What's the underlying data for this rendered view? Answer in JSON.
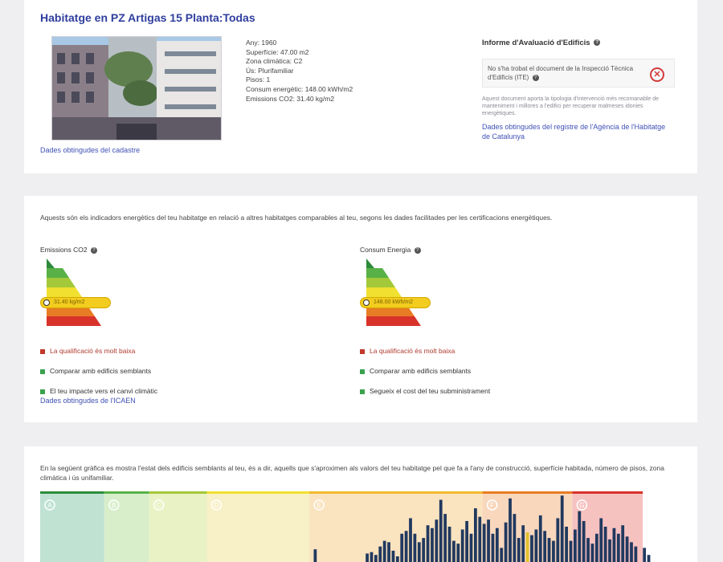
{
  "property": {
    "title": "Habitatge en PZ Artigas 15 Planta:Todas",
    "cadastre_link": "Dades obtingudes del cadastre",
    "facts": [
      "Any: 1960",
      "Superfície: 47.00 m2",
      "Zona climàtica: C2",
      "Ús: Plurifamiliar",
      "Pisos: 1",
      "Consum energètic: 148.00 kWh/m2",
      "Emissions CO2: 31.40 kg/m2"
    ],
    "iee": {
      "title": "Informe d'Avaluació d'Edificis",
      "status_text": "No s'ha trobat el document de la Inspecció Tècnica d'Edificis (ITE)",
      "note": "Aquest document aporta la tipologia d'intervenció més recomanable de manteniment i millores a l'edifici per recuperar malmeses idonies energètiques.",
      "link": "Dades obtingudes del registre de l'Agència de l'Habitatge de Catalunya",
      "status_color": "#d23c3c",
      "icon": "close-circle-icon"
    }
  },
  "indicators": {
    "intro": "Aquests són els indicadors energètics del teu habitatge en relació a altres habitatges comparables al teu, segons les dades facilitades per les certificacions energètiques.",
    "co2": {
      "title": "Emissions CO2",
      "marker": "31.40 kg/m2",
      "bullets": [
        {
          "text": "La qualificació és molt baixa",
          "type": "bad"
        },
        {
          "text": "Comparar amb edificis semblants",
          "type": "good"
        },
        {
          "text": "El teu impacte vers el canvi climàtic",
          "type": "good"
        }
      ]
    },
    "energy": {
      "title": "Consum Energia",
      "marker": "148.00 kWh/m2",
      "bullets": [
        {
          "text": "La qualificació és molt baixa",
          "type": "bad"
        },
        {
          "text": "Comparar amb edificis semblants",
          "type": "good"
        },
        {
          "text": "Segueix el cost del teu subministrament",
          "type": "good"
        }
      ]
    },
    "ocadi_link": "Dades obtingudes de l'ICAEN",
    "scale_colors": [
      "#2e8b3c",
      "#58b147",
      "#a3c83a",
      "#f0e030",
      "#f2b92d",
      "#e87c24",
      "#d8322b"
    ]
  },
  "comparison": {
    "intro": "En la següent gràfica es mostra l'estat dels edificis semblants al teu, és a dir, aquells que s'aproximen als valors del teu habitatge pel que fa a l'any de construcció, superfície habitada, número de pisos, zona climàtica i ús unifamiliar.",
    "chart_data": {
      "type": "bar",
      "band_labels": [
        "A",
        "B",
        "C",
        "D",
        "E",
        "F",
        "G"
      ],
      "band_colors": [
        "#bfe2d2",
        "#d8eecb",
        "#e9f2c4",
        "#f8f0c6",
        "#fae3bf",
        "#f8d7bd",
        "#f6c2c0"
      ],
      "band_widths": [
        0.1,
        0.07,
        0.09,
        0.16,
        0.27,
        0.14,
        0.11
      ],
      "values": [
        0,
        0,
        0,
        0,
        0,
        0,
        0,
        0,
        0,
        0,
        0,
        0,
        0,
        0,
        0,
        0,
        0,
        0,
        0,
        0,
        0,
        0,
        0,
        0,
        0,
        0,
        0,
        0,
        0,
        0,
        0,
        0,
        0,
        0,
        0,
        0,
        0,
        0,
        0,
        0,
        0,
        0,
        0,
        0,
        0,
        0,
        0,
        0,
        0,
        0,
        0,
        0,
        0,
        0,
        0,
        0,
        0,
        0,
        0,
        0,
        0,
        0,
        0,
        18,
        0,
        0,
        0,
        0,
        0,
        0,
        0,
        0,
        0,
        0,
        0,
        12,
        14,
        10,
        22,
        30,
        28,
        16,
        8,
        40,
        44,
        62,
        40,
        28,
        34,
        52,
        48,
        60,
        88,
        68,
        50,
        30,
        26,
        46,
        58,
        40,
        76,
        64,
        54,
        60,
        40,
        48,
        20,
        56,
        90,
        68,
        34,
        52,
        42,
        38,
        46,
        66,
        44,
        34,
        30,
        62,
        94,
        50,
        30,
        46,
        72,
        58,
        34,
        26,
        40,
        62,
        50,
        32,
        48,
        40,
        52,
        36,
        28,
        22,
        0,
        20,
        10,
        0,
        0,
        0,
        0,
        0,
        0,
        0
      ],
      "highlight_index": 112,
      "highlight_color": "#e2c12c",
      "bar_color": "#21395f"
    }
  }
}
